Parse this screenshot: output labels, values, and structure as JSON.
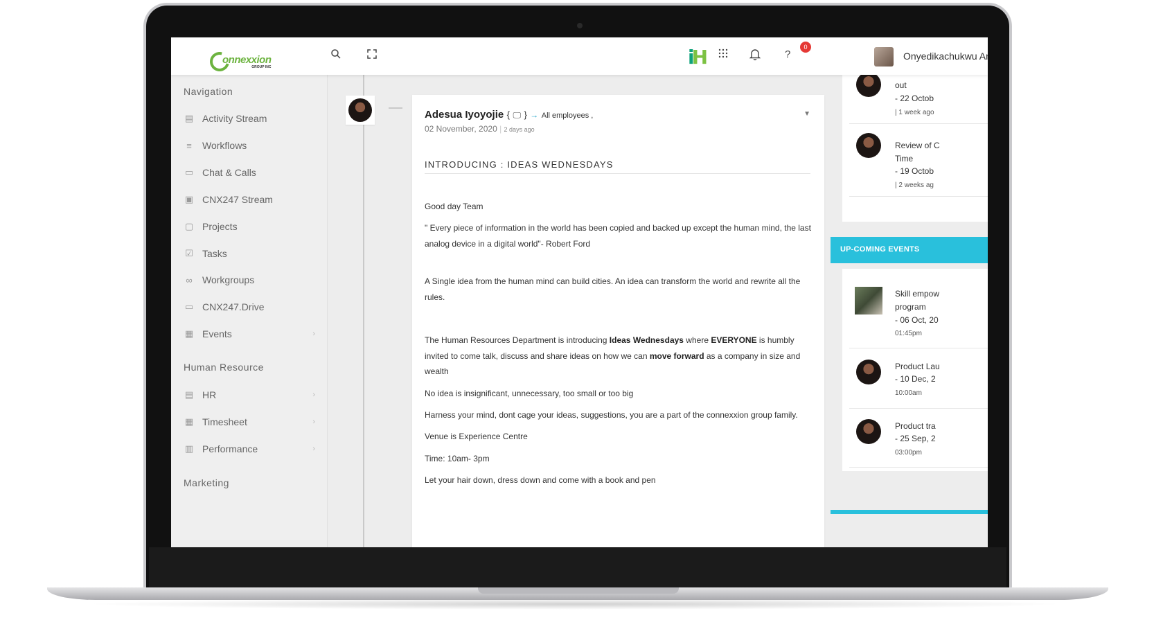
{
  "header": {
    "brand_main": "onnexxion",
    "brand_sub": "GROUP INC",
    "product_logo": "iH",
    "notification_count": "0",
    "user_name": "Onyedikachukwu An"
  },
  "sidebar": {
    "navigation_title": "Navigation",
    "nav_items": [
      {
        "label": "Activity Stream",
        "icon": "activity-icon"
      },
      {
        "label": "Workflows",
        "icon": "list-icon"
      },
      {
        "label": "Chat & Calls",
        "icon": "chat-icon"
      },
      {
        "label": "CNX247 Stream",
        "icon": "video-icon"
      },
      {
        "label": "Projects",
        "icon": "briefcase-icon"
      },
      {
        "label": "Tasks",
        "icon": "checkbox-icon"
      },
      {
        "label": "Workgroups",
        "icon": "infinity-icon"
      },
      {
        "label": "CNX247.Drive",
        "icon": "drive-icon"
      },
      {
        "label": "Events",
        "icon": "calendar-icon"
      }
    ],
    "hr_title": "Human Resource",
    "hr_items": [
      {
        "label": "HR",
        "icon": "id-card-icon"
      },
      {
        "label": "Timesheet",
        "icon": "calendar-icon"
      },
      {
        "label": "Performance",
        "icon": "bar-chart-icon"
      }
    ],
    "marketing_title": "Marketing"
  },
  "post": {
    "author": "Adesua Iyoyojie",
    "brace_open": "{",
    "brace_close": "}",
    "audience": "All employees ,",
    "date": "02 November, 2020",
    "ago": "2 days ago",
    "title": "INTRODUCING : IDEAS WEDNESDAYS",
    "greeting": "Good day Team",
    "quote": "\" Every piece of information in the world has been copied and backed up except the human mind, the last analog device in a digital world\"- Robert Ford",
    "para_idea": "A Single idea from the human mind can build cities. An idea can transform the world and rewrite all the rules.",
    "hr_intro_1": "The Human Resources Department is introducing ",
    "hr_intro_bold_1": "Ideas Wednesdays",
    "hr_intro_2": " where ",
    "hr_intro_bold_2": "EVERYONE",
    "hr_intro_3": " is humbly invited to come talk, discuss and share ideas on how we can ",
    "hr_intro_bold_3": "move forward",
    "hr_intro_4": " as a company in size and wealth",
    "no_idea": "No idea is insignificant, unnecessary, too small or too big",
    "harness": "Harness your mind, dont cage your ideas, suggestions, you are a part of the connexxion group family.",
    "venue": "Venue is Experience Centre",
    "time": "Time: 10am- 3pm",
    "closing": "Let your hair down, dress down and come with a book and pen"
  },
  "right_column": {
    "recent": [
      {
        "line1": "out",
        "date": "- 22 Octob",
        "ago": "| 1 week ago"
      },
      {
        "line1": "Review of C",
        "line2": "Time",
        "date": "- 19 Octob",
        "ago": "| 2 weeks ag"
      }
    ],
    "events_title": "UP-COMING EVENTS",
    "events": [
      {
        "line1": "Skill empow",
        "line2": "program",
        "date": "- 06 Oct, 20",
        "time": "01:45pm"
      },
      {
        "line1": "Product Lau",
        "date": "- 10 Dec, 2",
        "time": "10:00am"
      },
      {
        "line1": "Product tra",
        "date": "- 25 Sep, 2",
        "time": "03:00pm"
      }
    ]
  }
}
